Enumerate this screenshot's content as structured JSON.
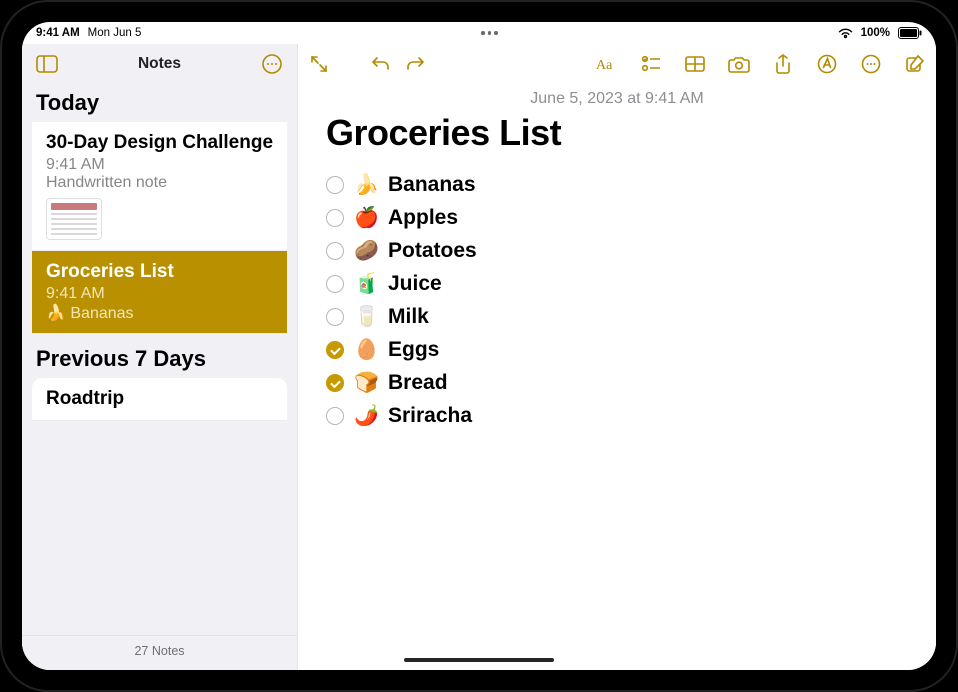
{
  "status": {
    "time": "9:41 AM",
    "date": "Mon Jun 5",
    "battery_pct": "100%"
  },
  "sidebar": {
    "title": "Notes",
    "sections": [
      {
        "header": "Today"
      },
      {
        "header": "Previous 7 Days"
      }
    ],
    "items": [
      {
        "title": "30-Day Design Challenge",
        "time": "9:41 AM",
        "preview": "Handwritten note"
      },
      {
        "title": "Groceries List",
        "time": "9:41 AM",
        "preview": "🍌 Bananas"
      },
      {
        "title": "Roadtrip"
      }
    ],
    "footer": "27 Notes"
  },
  "note": {
    "timestamp": "June 5, 2023 at 9:41 AM",
    "title": "Groceries List",
    "items": [
      {
        "emoji": "🍌",
        "text": "Bananas",
        "checked": false
      },
      {
        "emoji": "🍎",
        "text": "Apples",
        "checked": false
      },
      {
        "emoji": "🥔",
        "text": "Potatoes",
        "checked": false
      },
      {
        "emoji": "🧃",
        "text": "Juice",
        "checked": false
      },
      {
        "emoji": "🥛",
        "text": "Milk",
        "checked": false
      },
      {
        "emoji": "🥚",
        "text": "Eggs",
        "checked": true
      },
      {
        "emoji": "🍞",
        "text": "Bread",
        "checked": true
      },
      {
        "emoji": "🌶️",
        "text": "Sriracha",
        "checked": false
      }
    ]
  }
}
